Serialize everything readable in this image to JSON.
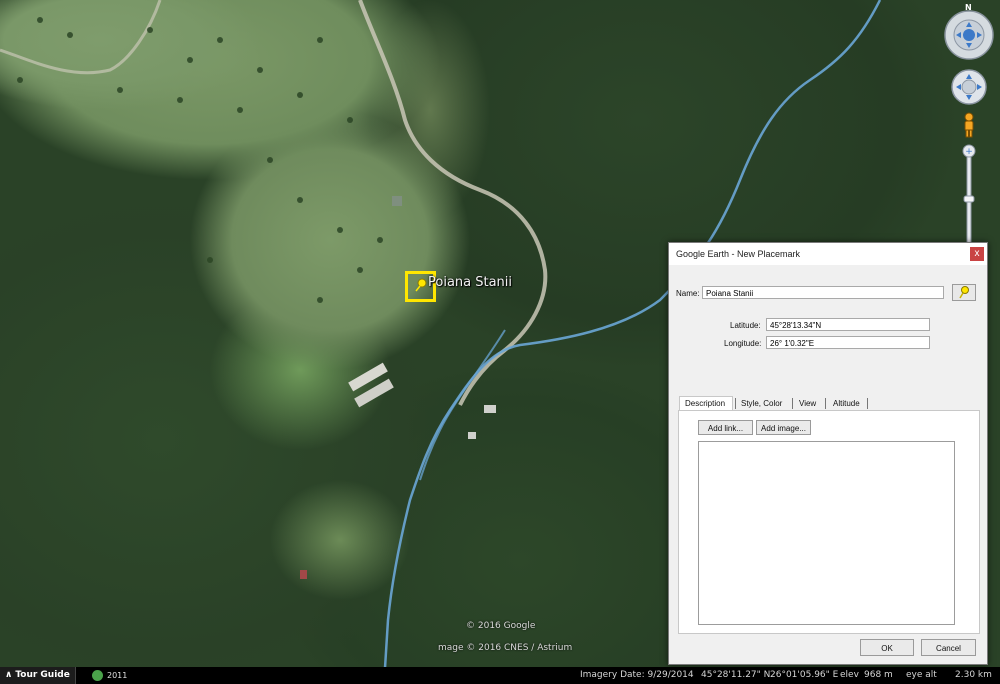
{
  "map": {
    "place_label": "Poiana Stanii",
    "copyright_google": "© 2016 Google",
    "copyright_imagery": "mage © 2016 CNES / Astrium"
  },
  "nav": {
    "north_label": "N"
  },
  "status_bar": {
    "tour_guide_label": "Tour Guide",
    "historical_year": "2011",
    "imagery_date": "Imagery Date: 9/29/2014",
    "latitude": "45°28'11.27\" N",
    "longitude": "26°01'05.96\" E",
    "elev_label": "elev",
    "elev_value": "968 m",
    "eye_alt_label": "eye alt",
    "eye_alt_value": "2.30 km"
  },
  "dialog": {
    "title": "Google Earth - New Placemark",
    "close_glyph": "x",
    "name_label": "Name:",
    "name_value": "Poiana Stanii",
    "latitude_label": "Latitude:",
    "latitude_value": "45°28'13.34\"N",
    "longitude_label": "Longitude:",
    "longitude_value": "26° 1'0.32\"E",
    "tabs": [
      "Description",
      "Style, Color",
      "View",
      "Altitude"
    ],
    "add_link_label": "Add link...",
    "add_image_label": "Add image...",
    "description_value": "",
    "ok_label": "OK",
    "cancel_label": "Cancel"
  },
  "colors": {
    "placemark_highlight": "#ffe600",
    "river": "#6aa6d6",
    "road": "#c9c7b6"
  }
}
